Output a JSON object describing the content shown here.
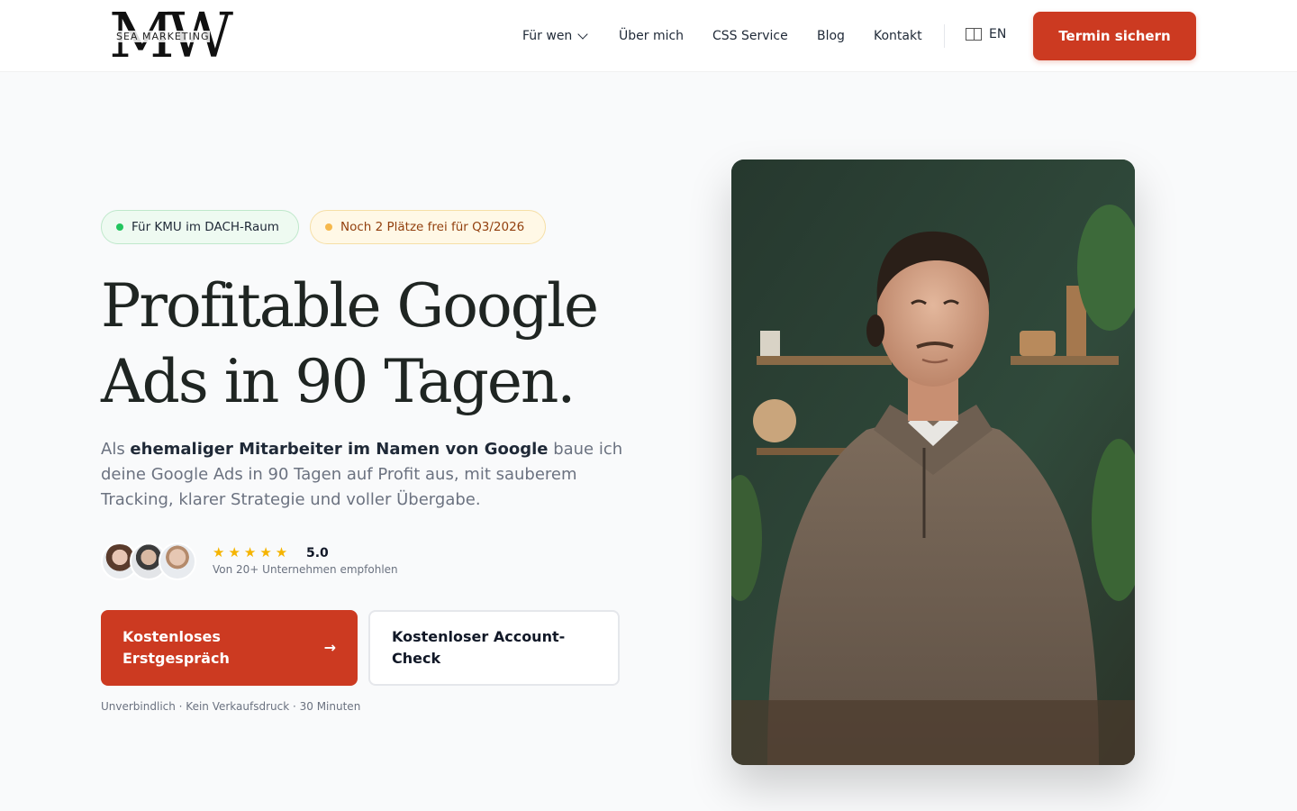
{
  "logo": {
    "mark": "MW",
    "subtitle": "SEA MARKETING"
  },
  "nav": {
    "items": [
      {
        "label": "Für wen",
        "has_dropdown": true
      },
      {
        "label": "Über mich"
      },
      {
        "label": "CSS Service"
      },
      {
        "label": "Blog"
      },
      {
        "label": "Kontakt"
      }
    ],
    "language": "EN",
    "cta": "Termin sichern"
  },
  "hero": {
    "badges": [
      {
        "label": "Für KMU im DACH-Raum",
        "dot_color": "#22c55e"
      },
      {
        "label": "Noch 2 Plätze frei für Q3/2026",
        "dot_color": "#f6b84b"
      }
    ],
    "headline_line1": "Profitable Google",
    "headline_line2": "Ads in 90 Tagen.",
    "lead_before": "Als ",
    "lead_bold": "ehemaliger Mitarbeiter im Namen von Google",
    "lead_after": " baue ich deine Google Ads in 90 Tagen auf Profit aus, mit sauberem Tracking, klarer Strategie und voller Übergabe.",
    "stars": "★★★★★",
    "rating": "5.0",
    "rating_sub": "Von 20+ Unternehmen empfohlen",
    "primary_cta": "Kostenloses Erstgespräch",
    "primary_cta_arrow": "→",
    "secondary_cta": "Kostenloser Account-Check",
    "fineprint": "Unverbindlich · Kein Verkaufsdruck · 30 Minuten"
  },
  "colors": {
    "accent": "#cc3a21",
    "star": "#f5b400",
    "badge_green_bg": "#eefaf1",
    "badge_amber_bg": "#fff8e6"
  }
}
